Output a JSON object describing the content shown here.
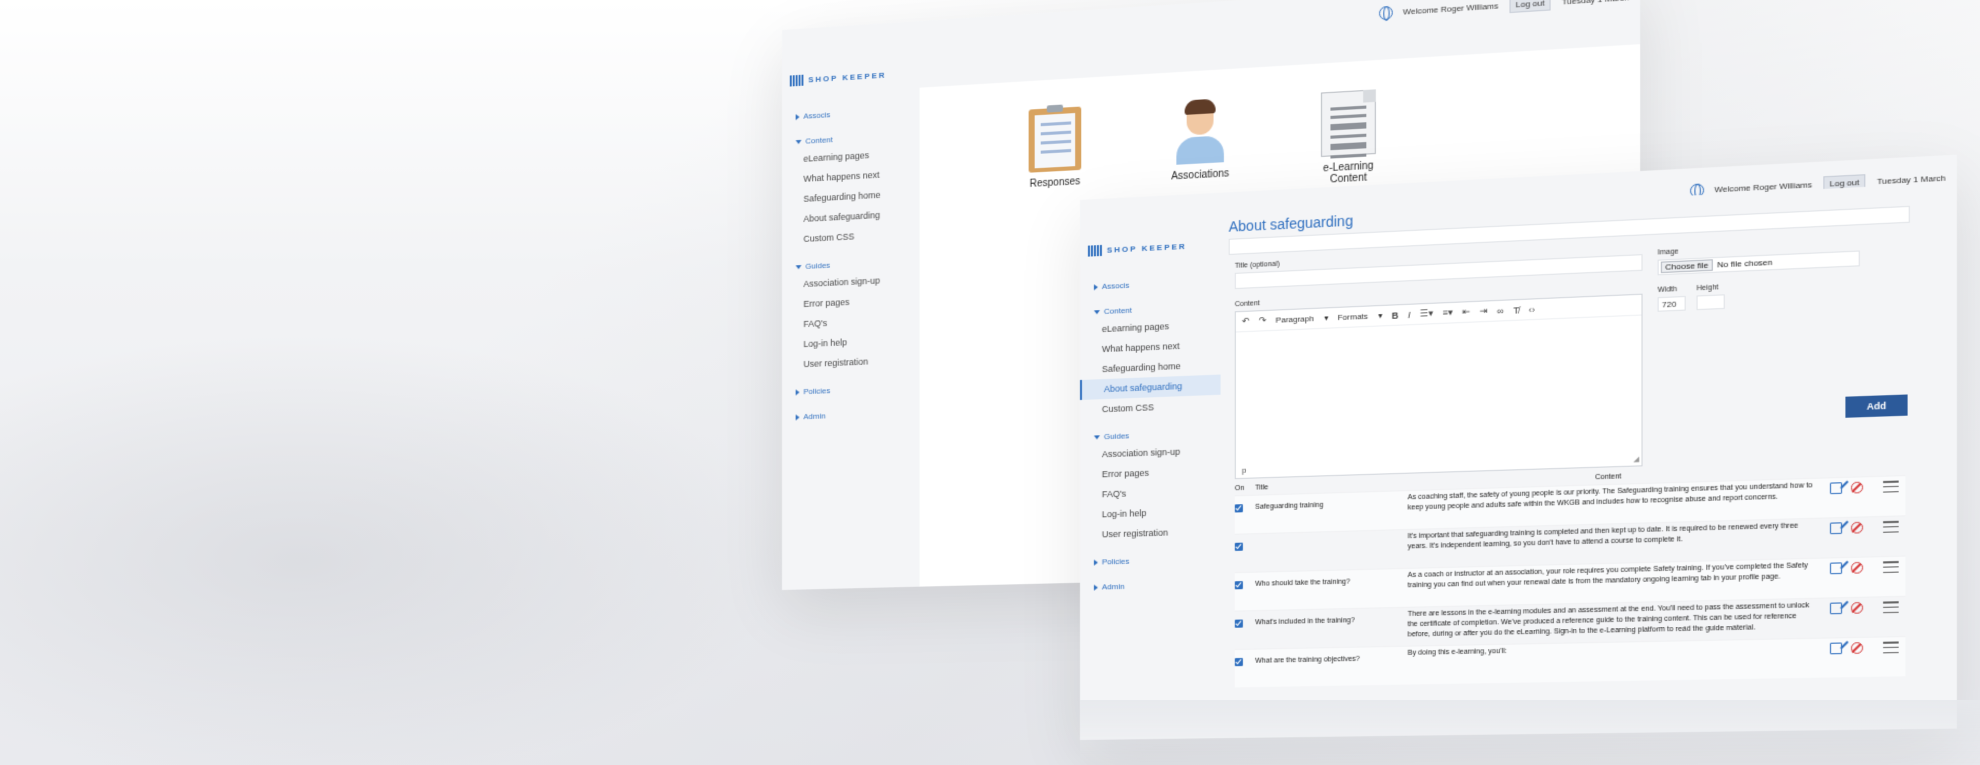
{
  "topbar": {
    "welcome": "Welcome Roger Williams",
    "logout_label": "Log out",
    "date": "Tuesday 1 March"
  },
  "logo": {
    "text": "SHOP KEEPER"
  },
  "sidebar": {
    "groups": [
      {
        "label": "Associs",
        "expanded": false,
        "items": []
      },
      {
        "label": "Content",
        "expanded": true,
        "items": [
          {
            "label": "eLearning pages"
          },
          {
            "label": "What happens next"
          },
          {
            "label": "Safeguarding home"
          },
          {
            "label": "About safeguarding"
          },
          {
            "label": "Custom CSS"
          }
        ]
      },
      {
        "label": "Guides",
        "expanded": true,
        "items": [
          {
            "label": "Association sign-up"
          },
          {
            "label": "Error pages"
          },
          {
            "label": "FAQ's"
          },
          {
            "label": "Log-in help"
          },
          {
            "label": "User registration"
          }
        ]
      },
      {
        "label": "Policies",
        "expanded": false,
        "items": []
      },
      {
        "label": "Admin",
        "expanded": false,
        "items": []
      }
    ],
    "active_item": "About safeguarding"
  },
  "back_screen": {
    "tiles": [
      {
        "label": "Responses",
        "icon": "clipboard-icon"
      },
      {
        "label": "Associations",
        "icon": "person-avatar-icon"
      },
      {
        "label": "e-Learning Content",
        "icon": "document-icon"
      }
    ]
  },
  "front_screen": {
    "page_title": "About safeguarding",
    "title_label": "Title (optional)",
    "content_label": "Content",
    "image_label": "Image",
    "choose_file_label": "Choose file",
    "no_file_text": "No file chosen",
    "width_label": "Width",
    "width_value": "720",
    "height_label": "Height",
    "height_value": "",
    "editor": {
      "paragraph_select": "Paragraph",
      "formats_select": "Formats",
      "status_path": "p"
    },
    "add_label": "Add",
    "table": {
      "headers": {
        "on": "On",
        "title": "Title",
        "content": "Content"
      },
      "rows": [
        {
          "title": "Safeguarding training",
          "content": "As coaching staff, the safety of young people is our priority. The Safeguarding training ensures that you understand how to keep young people and adults safe within the WKGB and includes how to recognise abuse and report concerns."
        },
        {
          "title": "",
          "content": "It's important that safeguarding training is completed and then kept up to date. It is required to be renewed every three years. It's independent learning, so you don't have to attend a course to complete it."
        },
        {
          "title": "Who should take the training?",
          "content": "As a coach or instructor at an association, your role requires you complete Safety training. If you've completed the Safety training you can find out when your renewal date is from the mandatory ongoing learning tab in your profile page."
        },
        {
          "title": "What's included in the training?",
          "content": "There are lessons in the e-learning modules and an assessment at the end. You'll need to pass the assessment to unlock the certificate of completion. We've produced a reference guide to the training content. This can be used for reference before, during or after you do the eLearning. Sign-in to the e-Learning platform to read the guide material."
        },
        {
          "title": "What are the training objectives?",
          "content": "By doing this e-learning, you'll:"
        }
      ]
    }
  },
  "colors": {
    "accent": "#2f6fbf",
    "add_button": "#2c5a9a",
    "ban": "#d63b3b"
  }
}
